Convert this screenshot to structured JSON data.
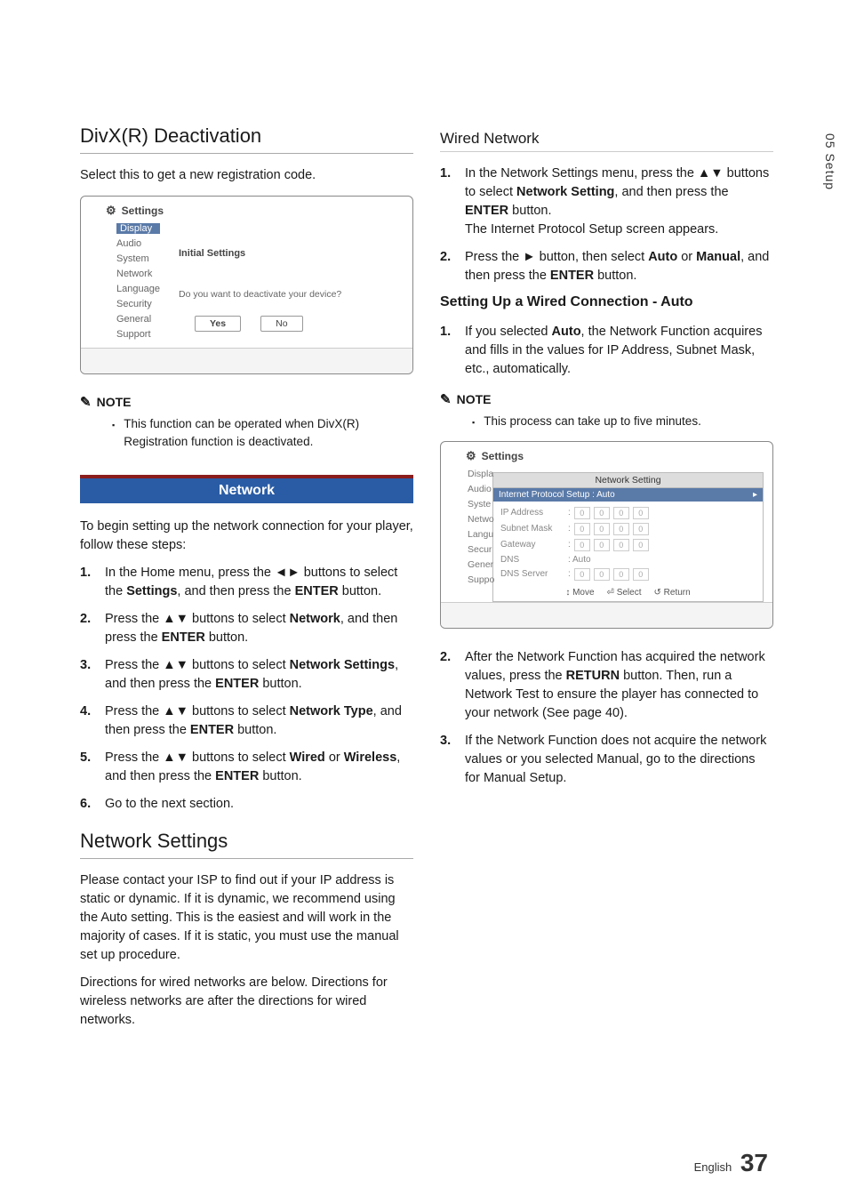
{
  "side": {
    "chapter": "05",
    "title": "Setup"
  },
  "left": {
    "h_divx": "DivX(R) Deactivation",
    "p_divx": "Select this to get a new registration code.",
    "box1": {
      "settings_label": "Settings",
      "menu": [
        "Display",
        "Audio",
        "System",
        "Network",
        "Language",
        "Security",
        "General",
        "Support"
      ],
      "selected_index": 0,
      "title": "Initial Settings",
      "question": "Do you want to deactivate your device?",
      "yes": "Yes",
      "no": "No"
    },
    "note_label": "NOTE",
    "note_item": "This function can be operated when DivX(R) Registration function is deactivated.",
    "banner": "Network",
    "p_begin": "To begin setting up the network connection for your player, follow these steps:",
    "steps": [
      {
        "n": "1.",
        "t": "In the Home menu, press the ◄► buttons to select the Settings, and then press the ENTER button.",
        "bold": [
          "Settings",
          "ENTER"
        ]
      },
      {
        "n": "2.",
        "t": "Press the ▲▼ buttons to select Network, and then press the ENTER button.",
        "bold": [
          "Network",
          "ENTER"
        ]
      },
      {
        "n": "3.",
        "t": "Press the ▲▼ buttons to select Network Settings, and then press the ENTER button.",
        "bold": [
          "Network Settings",
          "ENTER"
        ]
      },
      {
        "n": "4.",
        "t": "Press the ▲▼ buttons to select Network Type, and then press the ENTER button.",
        "bold": [
          "Network Type",
          "ENTER"
        ]
      },
      {
        "n": "5.",
        "t": "Press the ▲▼ buttons to select Wired or Wireless, and then press the ENTER button.",
        "bold": [
          "Wired",
          "Wireless",
          "ENTER"
        ]
      },
      {
        "n": "6.",
        "t": "Go to the next section."
      }
    ],
    "h_netset": "Network Settings",
    "p_netset1": "Please contact your ISP to find out if your IP address is static or dynamic. If it is dynamic, we recommend using the Auto setting. This is the easiest and will work in the majority of cases. If it is static, you must use the manual set up procedure.",
    "p_netset2": "Directions for wired networks are below. Directions for wireless networks are after the directions for wired networks."
  },
  "right": {
    "h_wired": "Wired Network",
    "steps_top": [
      {
        "n": "1.",
        "t1": "In the Network Settings menu, press the ▲▼ buttons to select ",
        "b1": "Network Setting",
        "t2": ", and then press the ",
        "b2": "ENTER",
        "t3": " button.",
        "extra": "The Internet Protocol Setup screen appears."
      },
      {
        "n": "2.",
        "t1": "Press the ► button, then select ",
        "b1": "Auto",
        "t2": " or ",
        "b2": "Manual",
        "t3": ", and then press the ",
        "b3": "ENTER",
        "t4": " button."
      }
    ],
    "h_autoconn": "Setting Up a Wired Connection - Auto",
    "step_auto": {
      "n": "1.",
      "t1": "If you selected ",
      "b1": "Auto",
      "t2": ", the Network Function acquires and fills in the values for IP Address, Subnet Mask, etc., automatically."
    },
    "note_label": "NOTE",
    "note_item": "This process can take up to five minutes.",
    "box2": {
      "settings_label": "Settings",
      "menu": [
        "Displa",
        "Audio",
        "Syste",
        "Netwo",
        "Langu",
        "Secur",
        "Gener",
        "Suppo"
      ],
      "panel_title": "Network Setting",
      "sel_label": "Internet Protocol Setup  : Auto",
      "rows": [
        {
          "label": "IP Address",
          "type": "oct"
        },
        {
          "label": "Subnet Mask",
          "type": "oct"
        },
        {
          "label": "Gateway",
          "type": "oct"
        },
        {
          "label": "DNS",
          "type": "text",
          "value": ": Auto"
        },
        {
          "label": "DNS Server",
          "type": "oct"
        }
      ],
      "oct_val": "0",
      "footer": [
        "↕ Move",
        "⏎ Select",
        "↺ Return"
      ]
    },
    "steps_bottom": [
      {
        "n": "2.",
        "t1": "After the Network Function has acquired the network values, press the ",
        "b1": "RETURN",
        "t2": " button. Then, run a Network Test to ensure the player has connected to your network (See page 40)."
      },
      {
        "n": "3.",
        "t1": "If the Network Function does not acquire the network values or you selected Manual, go to the directions for Manual Setup."
      }
    ]
  },
  "footer": {
    "lang": "English",
    "page": "37"
  }
}
